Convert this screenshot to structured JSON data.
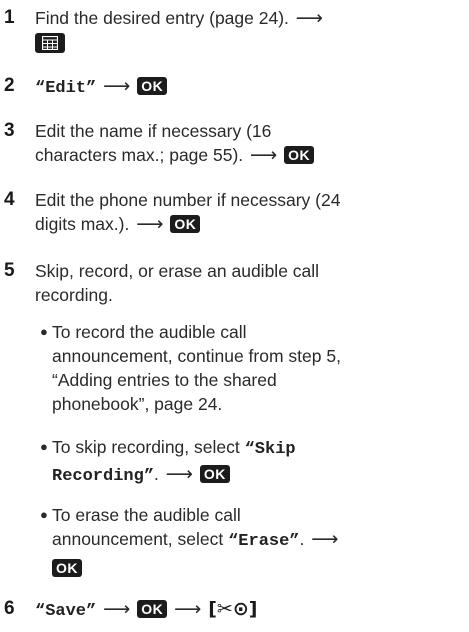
{
  "steps": [
    {
      "num": "1",
      "text": "Find the desired entry (page 24).",
      "icon": "phonebook-menu-icon"
    },
    {
      "num": "2",
      "key": "“Edit”",
      "button": "OK"
    },
    {
      "num": "3",
      "line1": "Edit the name if necessary (16",
      "line2": "characters max.; page 55).",
      "button": "OK"
    },
    {
      "num": "4",
      "line1": "Edit the phone number if necessary (24",
      "line2": "digits max.).",
      "button": "OK"
    },
    {
      "num": "5",
      "line1": "Skip, record, or erase an audible call",
      "line2": "recording."
    },
    {
      "num": "6",
      "key": "“Save”",
      "button": "OK",
      "end_key": "[✂⊙]"
    }
  ],
  "bullets": [
    {
      "lines": [
        "To record the audible call",
        "announcement, continue from step 5,",
        "“Adding entries to the shared",
        "phonebook”, page 24."
      ]
    },
    {
      "line1": "To skip recording, select ",
      "key1": "“Skip",
      "key2": "Recording”",
      "tail": ".",
      "button": "OK"
    },
    {
      "line1": "To erase the audible call",
      "line2a": "announcement, select ",
      "key": "“Erase”",
      "tail": ".",
      "button": "OK"
    }
  ],
  "arrow": "⟶",
  "bullet_glyph": "●"
}
